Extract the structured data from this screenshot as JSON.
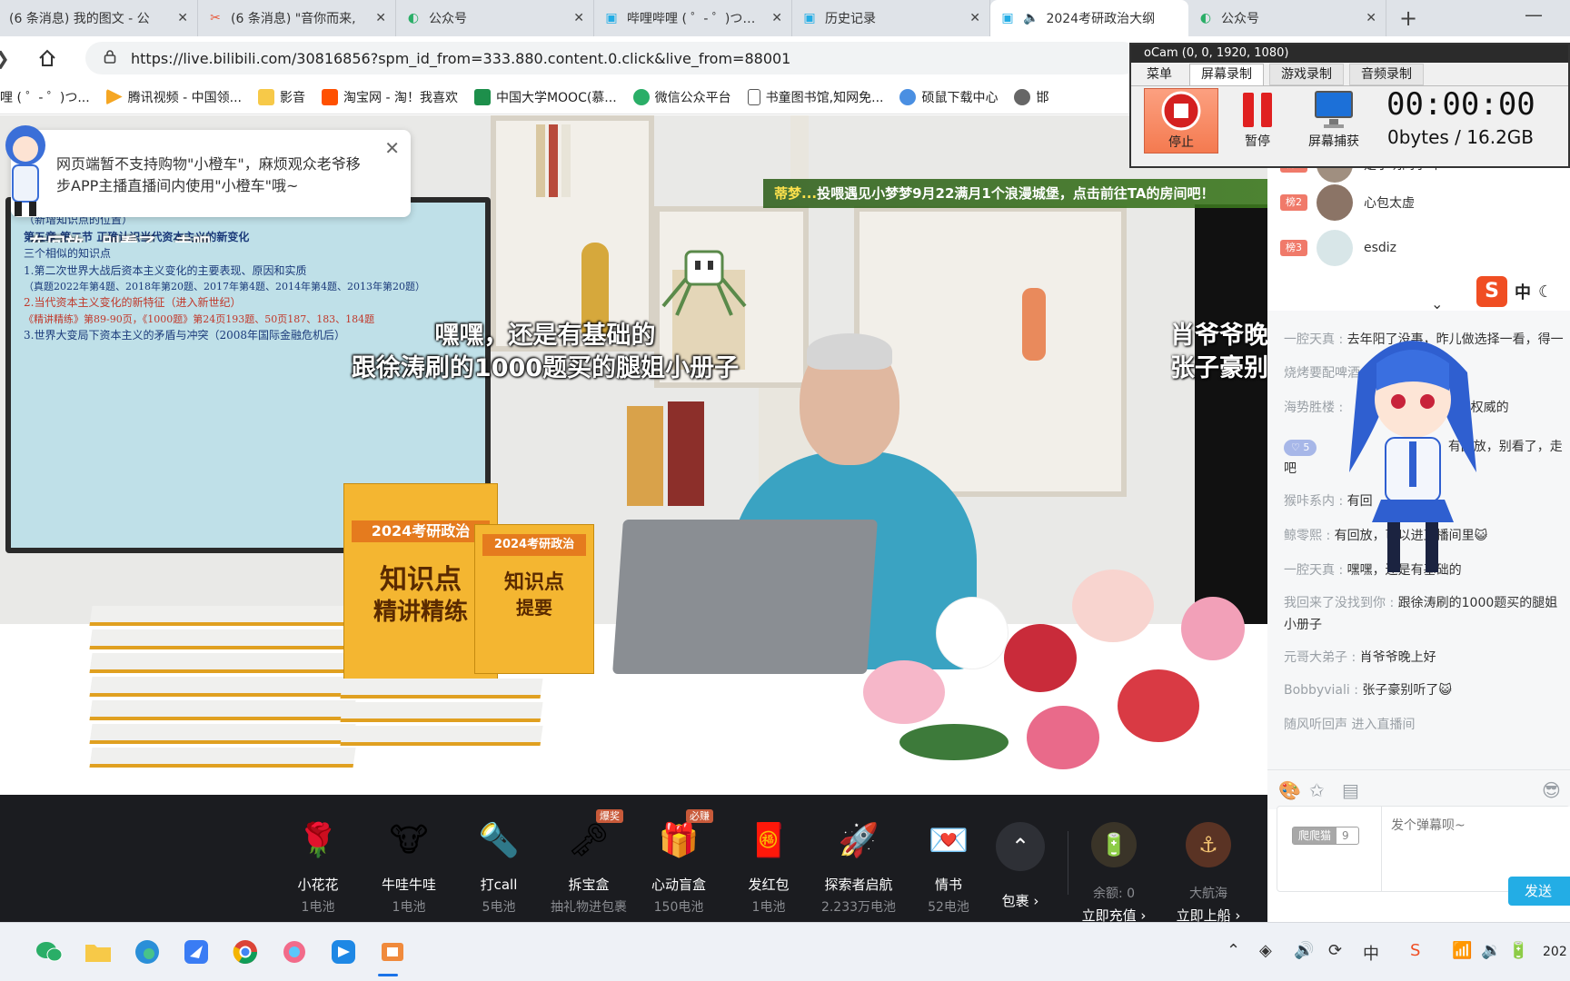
{
  "browser": {
    "tabs": [
      {
        "title": "(6 条消息) 我的图文 - 公"
      },
      {
        "title": "(6 条消息) \"音你而来,"
      },
      {
        "title": "公众号"
      },
      {
        "title": "哔哩哔哩 ( ゜- ゜)つロ 千"
      },
      {
        "title": "历史记录"
      },
      {
        "title": "2024考研政治大纲"
      },
      {
        "title": "公众号"
      }
    ],
    "url": "https://live.bilibili.com/30816856?spm_id_from=333.880.content.0.click&live_from=88001",
    "bookmarks": [
      "哩 ( ゜- ゜)つ...",
      "腾讯视频 - 中国领...",
      "影音",
      "淘宝网 - 淘！我喜欢",
      "中国大学MOOC(慕...",
      "微信公众平台",
      "书童图书馆,知网免...",
      "硕鼠下载中心",
      "邯"
    ]
  },
  "video": {
    "partial_title": "车回放，别看了，走吧",
    "notice": "网页端暂不支持购物\"小橙车\"，麻烦观众老爷移步APP主播直播间内使用\"小橙车\"哦~",
    "banner_name": "蒂梦...",
    "banner_text": "投喂遇见小梦梦9月22满月1个浪漫城堡，点击前往TA的房间吧！",
    "subtitle_line1": "嘿嘿，还是有基础的",
    "subtitle_line2": "跟徐涛刷的1000题买的腿姐小册子",
    "subtitle_right_line1": "肖爷爷晚",
    "subtitle_right_line2": "张子豪别",
    "tv_lines": [
      "（新增知识点的位置）",
      "第五章 第二节 正确认识当代资本主义的新变化",
      "三个相似的知识点",
      "1.第二次世界大战后资本主义变化的主要表现、原因和实质",
      "（真题2022年第4题、2018年第20题、2017年第4题、2014年第4题、2013年第20题）",
      "2.当代资本主义变化的新特征（进入新世纪）",
      "《精讲精练》第89-90页，《1000题》第24页193题、50页187、183、184题",
      "3.世界大变局下资本主义的矛盾与冲突（2008年国际金融危机后）"
    ],
    "book_main_year": "2024考研政治",
    "book_main_title1": "知识点",
    "book_main_title2": "精讲精练",
    "book_second_year": "2024考研政治",
    "book_second_title1": "知识点",
    "book_second_title2": "提要"
  },
  "gifts": [
    {
      "name": "小花花",
      "price": "1电池",
      "icon": "🌹",
      "badge": ""
    },
    {
      "name": "牛哇牛哇",
      "price": "1电池",
      "icon": "🐮",
      "badge": ""
    },
    {
      "name": "打call",
      "price": "5电池",
      "icon": "🔦",
      "badge": ""
    },
    {
      "name": "拆宝盒",
      "price": "抽礼物进包裹",
      "icon": "🗝",
      "badge": "爆奖"
    },
    {
      "name": "心动盲盒",
      "price": "150电池",
      "icon": "🎁",
      "badge": "必赚"
    },
    {
      "name": "发红包",
      "price": "1电池",
      "icon": "🧧",
      "badge": ""
    },
    {
      "name": "探索者启航",
      "price": "2.233万电池",
      "icon": "🚀",
      "badge": ""
    },
    {
      "name": "情书",
      "price": "52电池",
      "icon": "💌",
      "badge": ""
    }
  ],
  "gift_actions": {
    "pack": "包裹",
    "balance": "余额: 0",
    "recharge": "立即充值",
    "captain": "大航海",
    "board": "立即上船"
  },
  "ranking": [
    {
      "badge": "榜1",
      "name": "是小明同学吖",
      "color": "#f07a6a"
    },
    {
      "badge": "榜2",
      "name": "心包太虚",
      "color": "#f07a6a"
    },
    {
      "badge": "榜3",
      "name": "esdiz",
      "color": "#f07a6a"
    }
  ],
  "chat": [
    {
      "user": "一腔天真",
      "text": "去年阳了没事，昨儿做选择一看，得一"
    },
    {
      "user": "烧烤要配啤酒",
      "text": ""
    },
    {
      "user": "海势胜楼",
      "text": "肯定是最权威的"
    },
    {
      "user": "",
      "text": "有回放，别看了，走吧"
    },
    {
      "user": "猴咔系内",
      "text": "有回"
    },
    {
      "user": "鲸零熙",
      "text": "有回放，可以进直播间里😺"
    },
    {
      "user": "一腔天真",
      "text": "嘿嘿，还是有基础的"
    },
    {
      "user": "我回来了没找到你",
      "text": "跟徐涛刷的1000题买的腿姐小册子"
    },
    {
      "user": "元哥大弟子",
      "text": "肖爷爷晚上好"
    },
    {
      "user": "Bobbyviali",
      "text": "张子豪别听了😺"
    },
    {
      "user": "随风听回声",
      "text": "进入直播间"
    }
  ],
  "chat_level_badge": "5",
  "chat_input": {
    "placeholder": "发个弹幕呗~",
    "medal_name": "爬爬猫",
    "medal_level": "9",
    "send": "发送"
  },
  "ime": {
    "logo": "S",
    "mode": "中"
  },
  "ocam": {
    "title": "oCam (0, 0, 1920, 1080)",
    "tabs": [
      "菜单",
      "屏幕录制",
      "游戏录制",
      "音频录制"
    ],
    "stop": "停止",
    "pause": "暂停",
    "capture": "屏幕捕获",
    "timer": "00:00:00",
    "size": "0bytes / 16.2GB"
  },
  "taskbar": {
    "clock": "202"
  },
  "colors": {
    "gift_bar_bg": "#1b1c20",
    "send_button": "#23ade5",
    "banner_name": "#ffe24d"
  }
}
